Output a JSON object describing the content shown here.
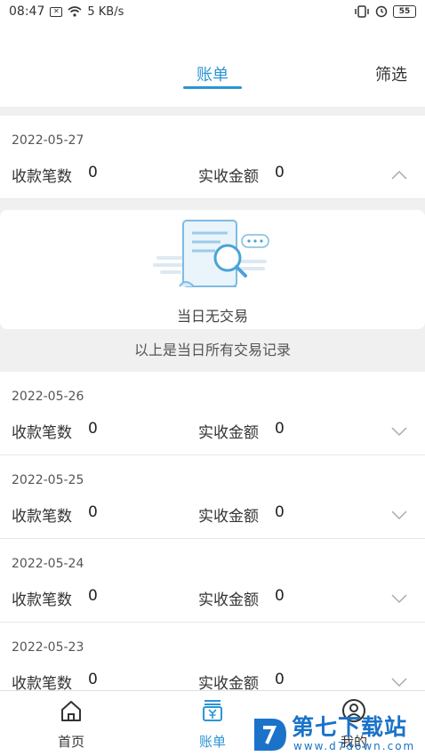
{
  "status_bar": {
    "time": "08:47",
    "network_speed": "5 KB/s",
    "battery": "55"
  },
  "header": {
    "tab_title": "账单",
    "filter_label": "筛选",
    "accent_color": "#2a95d4"
  },
  "expanded_day": {
    "date": "2022-05-27",
    "count_label": "收款笔数",
    "count_value": "0",
    "amount_label": "实收金额",
    "amount_value": "0"
  },
  "empty_state": {
    "text": "当日无交易",
    "all_records_text": "以上是当日所有交易记录"
  },
  "days": [
    {
      "date": "2022-05-26",
      "count_label": "收款笔数",
      "count_value": "0",
      "amount_label": "实收金额",
      "amount_value": "0"
    },
    {
      "date": "2022-05-25",
      "count_label": "收款笔数",
      "count_value": "0",
      "amount_label": "实收金额",
      "amount_value": "0"
    },
    {
      "date": "2022-05-24",
      "count_label": "收款笔数",
      "count_value": "0",
      "amount_label": "实收金额",
      "amount_value": "0"
    },
    {
      "date": "2022-05-23",
      "count_label": "收款笔数",
      "count_value": "0",
      "amount_label": "实收金额",
      "amount_value": "0"
    }
  ],
  "bottom_nav": {
    "items": [
      {
        "label": "首页",
        "icon": "home-icon"
      },
      {
        "label": "账单",
        "icon": "bill-icon"
      },
      {
        "label": "我的",
        "icon": "user-icon"
      }
    ]
  },
  "watermark": {
    "text": "第七下载站",
    "url": "www.d7down.com"
  }
}
